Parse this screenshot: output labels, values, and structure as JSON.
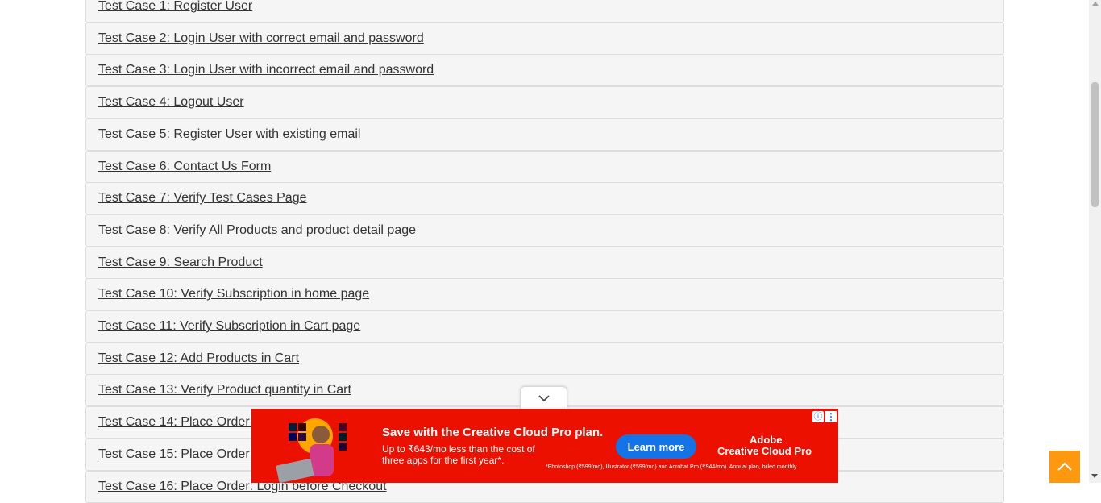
{
  "test_cases": [
    "Test Case 1: Register User",
    "Test Case 2: Login User with correct email and password",
    "Test Case 3: Login User with incorrect email and password",
    "Test Case 4: Logout User",
    "Test Case 5: Register User with existing email",
    "Test Case 6: Contact Us Form",
    "Test Case 7: Verify Test Cases Page",
    "Test Case 8: Verify All Products and product detail page",
    "Test Case 9: Search Product",
    "Test Case 10: Verify Subscription in home page",
    "Test Case 11: Verify Subscription in Cart page",
    "Test Case 12: Add Products in Cart",
    "Test Case 13: Verify Product quantity in Cart",
    "Test Case 14: Place Order: Register while Checkout",
    "Test Case 15: Place Order: Register before Checkout",
    "Test Case 16: Place Order: Login before Checkout"
  ],
  "ad": {
    "headline": "Save with the Creative Cloud Pro plan.",
    "subtext": "Up to ₹643/mo less than the cost of three apps for the first year*.",
    "cta": "Learn more",
    "brand_line1": "Adobe",
    "brand_line2": "Creative Cloud Pro",
    "fineprint": "*Photoshop (₹599/mo), Illustrator (₹599/mo) and Acrobat Pro (₹944/mo). Annual plan, billed monthly.",
    "info_glyph": "ⓘ",
    "menu_glyph": "⋮"
  },
  "colors": {
    "accent": "#fe980f",
    "ad_background": "#eb1000",
    "ad_button": "#1473e6",
    "row_background": "#f5f5f5"
  },
  "icons": {
    "collapse": "chevron-down-icon",
    "scroll_top": "chevron-up-icon"
  }
}
